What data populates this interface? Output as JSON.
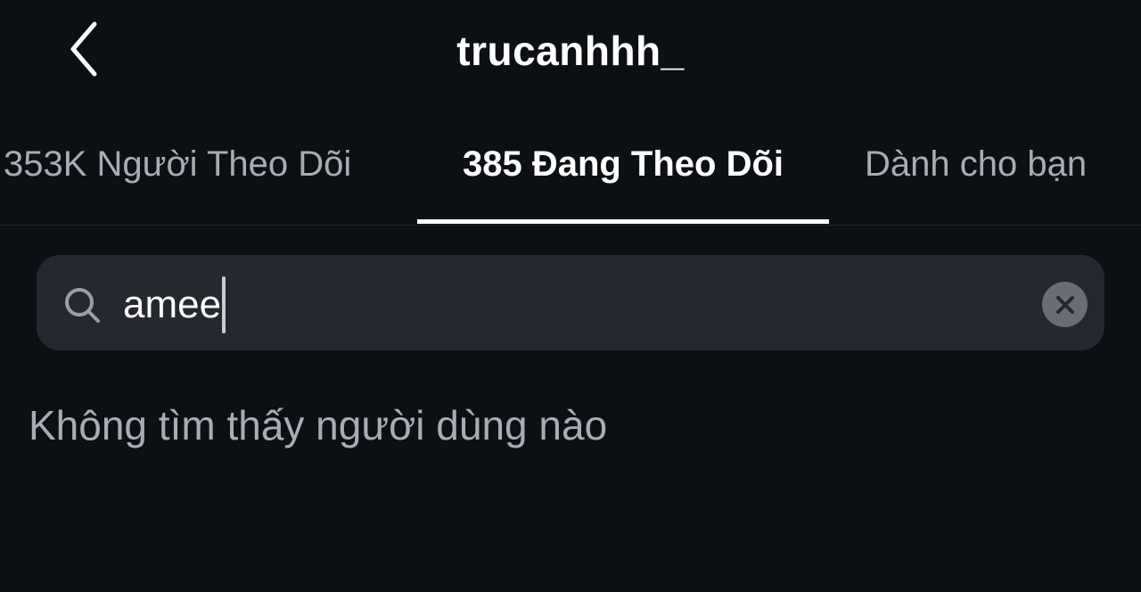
{
  "header": {
    "title": "trucanhhh_",
    "back_icon": "chevron-left-icon"
  },
  "tabs": [
    {
      "label": "353K Người Theo Dõi",
      "selected": false
    },
    {
      "label": "385 Đang Theo Dõi",
      "selected": true
    },
    {
      "label": "Dành cho bạn",
      "selected": false
    }
  ],
  "search": {
    "value": "amee",
    "search_icon": "search-icon",
    "clear_icon": "close-icon"
  },
  "results": {
    "empty_message": "Không tìm thấy người dùng nào"
  },
  "colors": {
    "background": "#0c0f14",
    "search_background": "#25282e",
    "muted_text": "#a8acb3",
    "active_text": "#ffffff"
  }
}
